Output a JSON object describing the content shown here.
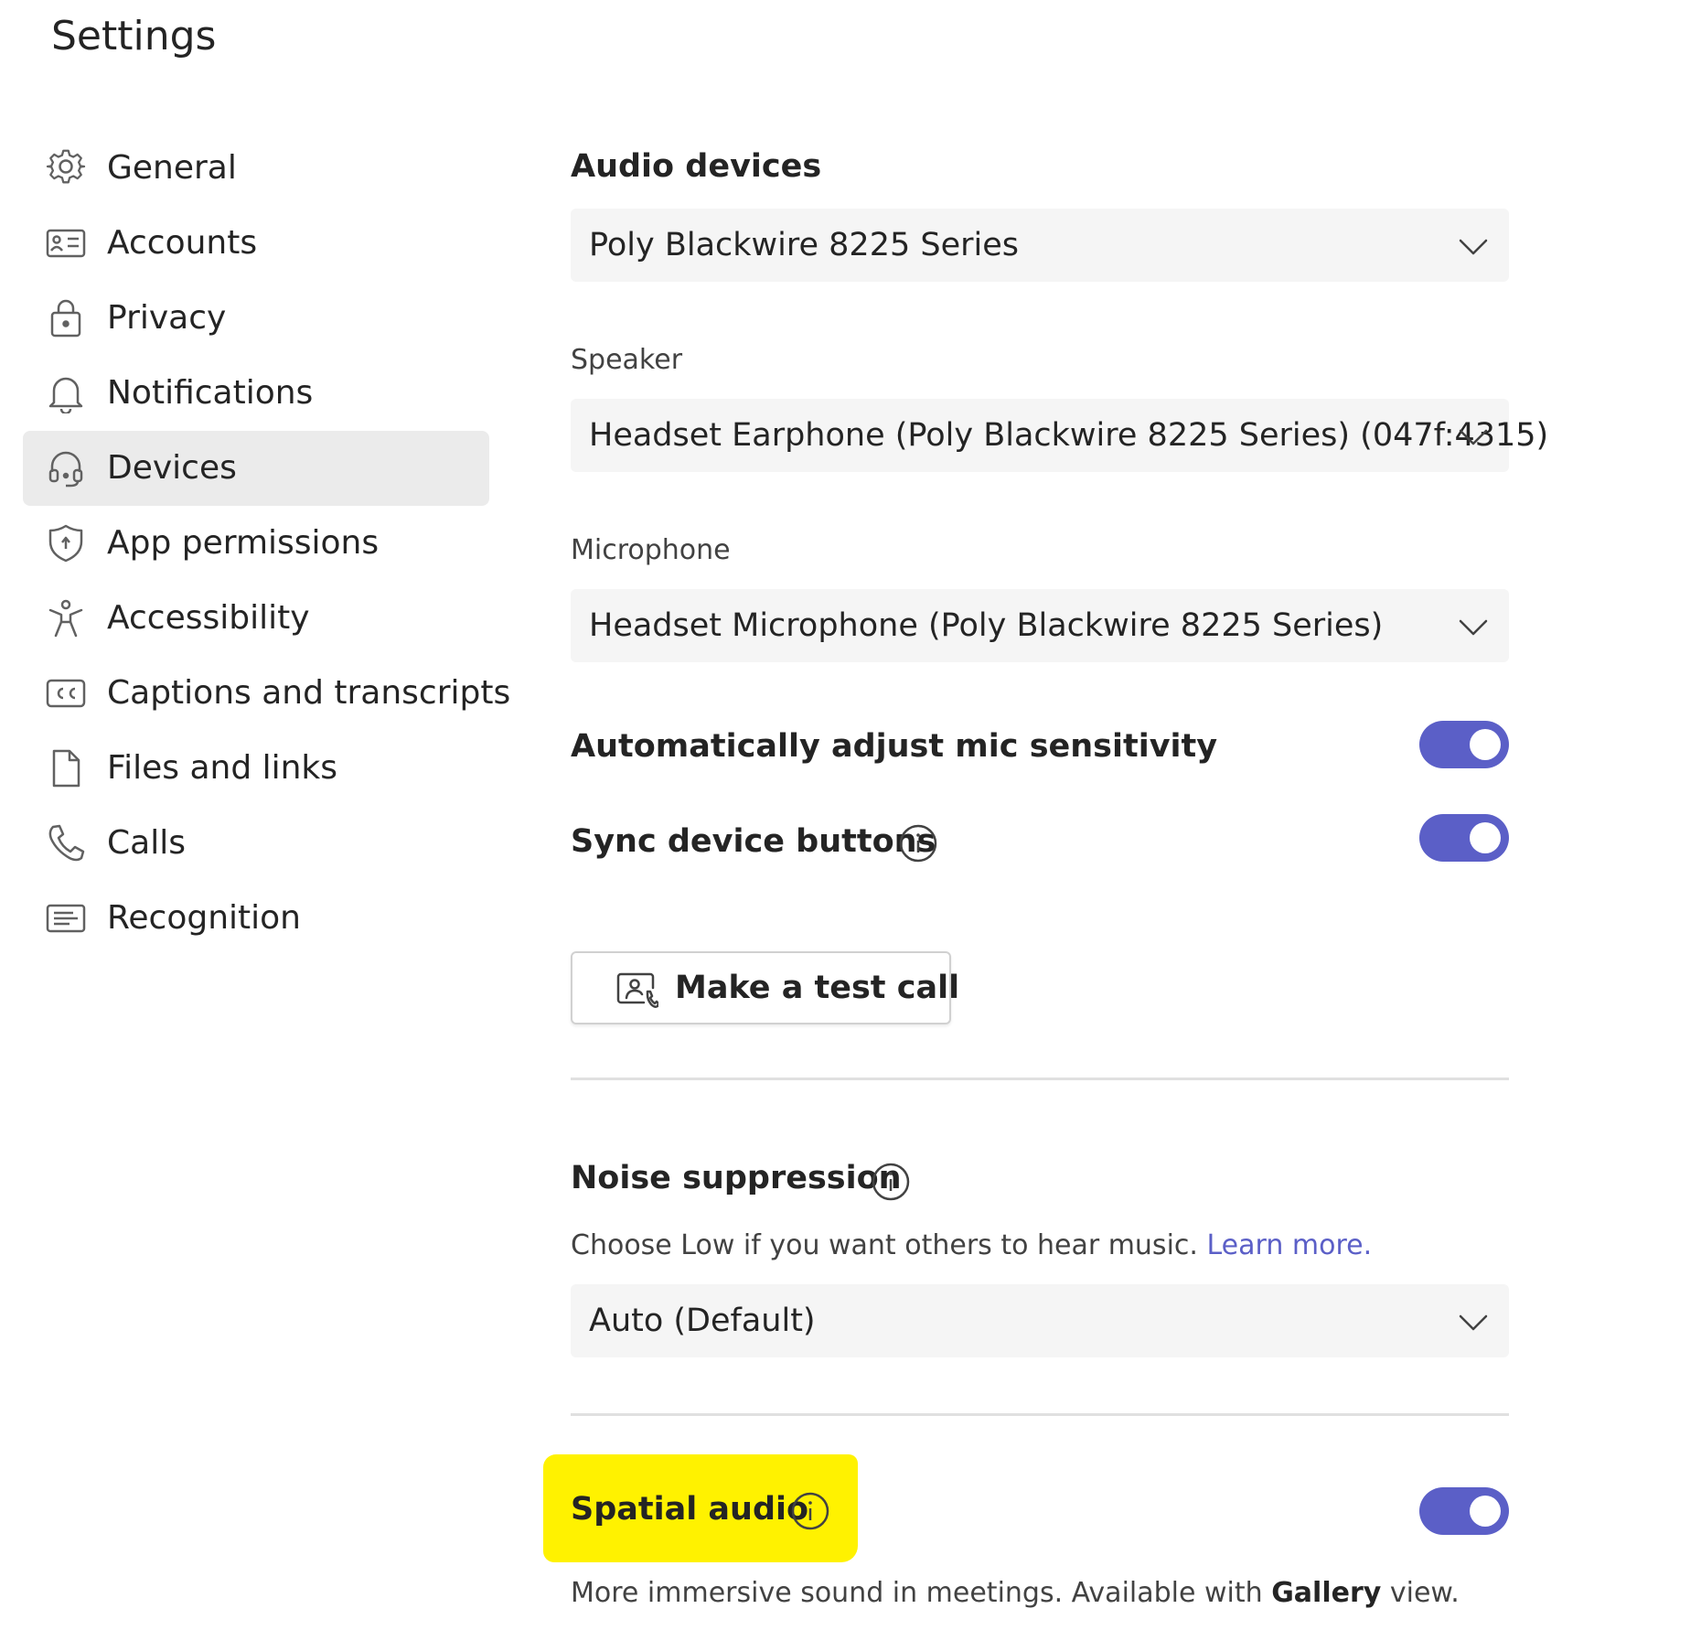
{
  "page": {
    "title": "Settings"
  },
  "colors": {
    "accent": "#5b5fc7",
    "highlight": "#fff200",
    "active_nav_bg": "#ebebeb",
    "select_bg": "#f5f5f5"
  },
  "sidebar": {
    "items": [
      {
        "label": "General",
        "icon": "gear-icon"
      },
      {
        "label": "Accounts",
        "icon": "id-card-icon"
      },
      {
        "label": "Privacy",
        "icon": "lock-icon"
      },
      {
        "label": "Notifications",
        "icon": "bell-icon"
      },
      {
        "label": "Devices",
        "icon": "headset-icon",
        "active": true
      },
      {
        "label": "App permissions",
        "icon": "shield-icon"
      },
      {
        "label": "Accessibility",
        "icon": "accessibility-icon"
      },
      {
        "label": "Captions and transcripts",
        "icon": "closed-captions-icon"
      },
      {
        "label": "Files and links",
        "icon": "file-icon"
      },
      {
        "label": "Calls",
        "icon": "phone-icon"
      },
      {
        "label": "Recognition",
        "icon": "recognition-icon"
      }
    ]
  },
  "audio": {
    "heading": "Audio devices",
    "device_value": "Poly Blackwire 8225 Series",
    "speaker_label": "Speaker",
    "speaker_value": "Headset Earphone (Poly Blackwire 8225 Series) (047f:4315)",
    "microphone_label": "Microphone",
    "microphone_value": "Headset Microphone (Poly Blackwire 8225 Series)"
  },
  "toggles": {
    "auto_mic": {
      "label": "Automatically adjust mic sensitivity",
      "on": true
    },
    "sync_buttons": {
      "label": "Sync device buttons",
      "on": true
    }
  },
  "test_call": {
    "label": "Make a test call"
  },
  "noise": {
    "heading": "Noise suppression",
    "description": "Choose Low if you want others to hear music.",
    "link": "Learn more.",
    "value": "Auto (Default)"
  },
  "spatial": {
    "label": "Spatial audio",
    "on": true,
    "description_prefix": "More immersive sound in meetings. Available with",
    "description_bold": "Gallery",
    "description_suffix": "view."
  }
}
